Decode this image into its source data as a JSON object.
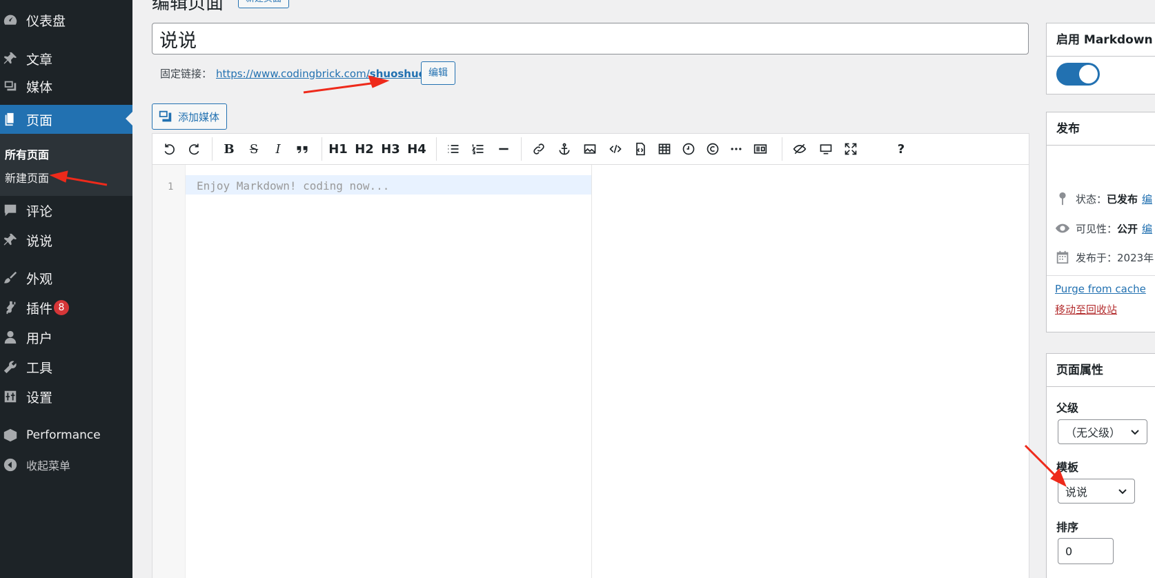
{
  "sidebar": {
    "items": [
      {
        "label": "仪表盘",
        "icon": "dashboard-icon"
      },
      {
        "label": "文章",
        "icon": "pin-icon"
      },
      {
        "label": "媒体",
        "icon": "media-icon"
      },
      {
        "label": "页面",
        "icon": "page-icon"
      },
      {
        "label": "评论",
        "icon": "comment-icon"
      },
      {
        "label": "说说",
        "icon": "pin-icon"
      },
      {
        "label": "外观",
        "icon": "brush-icon"
      },
      {
        "label": "插件",
        "icon": "plugin-icon",
        "badge": "8"
      },
      {
        "label": "用户",
        "icon": "user-icon"
      },
      {
        "label": "工具",
        "icon": "wrench-icon"
      },
      {
        "label": "设置",
        "icon": "settings-icon"
      },
      {
        "label": "Performance",
        "icon": "performance-icon"
      },
      {
        "label": "收起菜单",
        "icon": "collapse-icon"
      }
    ],
    "submenu": {
      "all_pages": "所有页面",
      "new_page": "新建页面"
    }
  },
  "header": {
    "title": "编辑页面",
    "add_new": "新建页面"
  },
  "post_title": "说说",
  "permalink": {
    "label": "固定链接：",
    "base": "https://www.codingbrick.com/",
    "slug": "shuoshuo",
    "edit_button": "编辑"
  },
  "add_media": "添加媒体",
  "editor": {
    "toolbar": [
      "undo",
      "redo",
      "bold",
      "strikethrough",
      "italic",
      "quote",
      "H1",
      "H2",
      "H3",
      "H4",
      "list-ul",
      "list-ol",
      "hr",
      "link",
      "anchor",
      "image",
      "code",
      "code-block",
      "table",
      "datetime",
      "html-entities",
      "pagebreak",
      "preview-html",
      "watch",
      "preview",
      "fullscreen",
      "help"
    ],
    "labels": {
      "bold": "B",
      "strike": "S",
      "italic": "I",
      "h1": "H1",
      "h2": "H2",
      "h3": "H3",
      "h4": "H4",
      "help": "?"
    },
    "line_number": "1",
    "placeholder": "Enjoy Markdown! coding now..."
  },
  "markdown_panel": {
    "title": "启用 Markdown",
    "enabled": true
  },
  "publish_panel": {
    "title": "发布",
    "status_label": "状态：",
    "status_value": "已发布",
    "status_edit": "编",
    "visibility_label": "可见性：",
    "visibility_value": "公开",
    "visibility_edit": "编",
    "published_label": "发布于：",
    "published_value": "2023年",
    "purge": "Purge from cache",
    "trash": "移动至回收站"
  },
  "attributes_panel": {
    "title": "页面属性",
    "parent_label": "父级",
    "parent_value": "（无父级）",
    "template_label": "模板",
    "template_value": "说说",
    "order_label": "排序",
    "order_value": "0"
  },
  "colors": {
    "accent": "#2271b1",
    "sidebar_bg": "#1d2327",
    "badge": "#d63638",
    "annotation_arrow": "#ee2a1b"
  }
}
